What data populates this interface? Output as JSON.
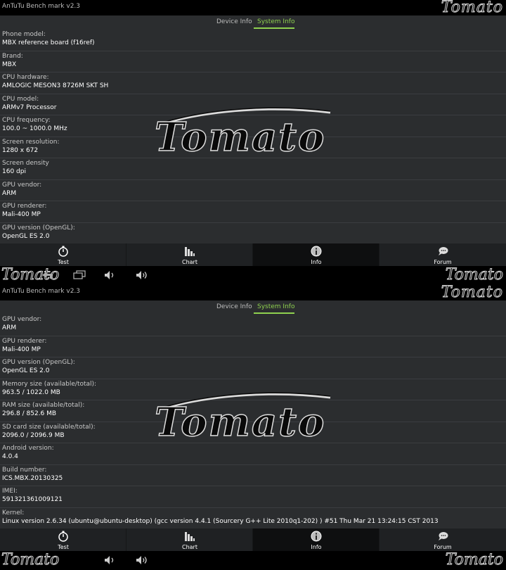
{
  "app_title": "AnTuTu Bench mark v2.3",
  "watermark": "Tomato",
  "tabs": {
    "device_info": "Device Info",
    "system_info": "System Info"
  },
  "top_rows": [
    {
      "label": "Phone model:",
      "value": "MBX reference board (f16ref)"
    },
    {
      "label": "Brand:",
      "value": "MBX"
    },
    {
      "label": "CPU hardware:",
      "value": "AMLOGIC MESON3 8726M SKT SH"
    },
    {
      "label": "CPU model:",
      "value": "ARMv7 Processor"
    },
    {
      "label": "CPU frequency:",
      "value": "100.0 ~ 1000.0 MHz"
    },
    {
      "label": "Screen resolution:",
      "value": "1280 x 672"
    },
    {
      "label": "Screen density",
      "value": "160 dpi"
    },
    {
      "label": "GPU vendor:",
      "value": "ARM"
    },
    {
      "label": "GPU renderer:",
      "value": "Mali-400 MP"
    },
    {
      "label": "GPU version (OpenGL):",
      "value": "OpenGL ES 2.0"
    }
  ],
  "bottom_rows": [
    {
      "label": "GPU vendor:",
      "value": "ARM"
    },
    {
      "label": "GPU renderer:",
      "value": "Mali-400 MP"
    },
    {
      "label": "GPU version (OpenGL):",
      "value": "OpenGL ES 2.0"
    },
    {
      "label": "Memory size (available/total):",
      "value": "963.5 / 1022.0 MB"
    },
    {
      "label": "RAM size (available/total):",
      "value": "296.8 / 852.6 MB"
    },
    {
      "label": "SD card size (available/total):",
      "value": "2096.0 / 2096.9 MB"
    },
    {
      "label": "Android version:",
      "value": "4.0.4"
    },
    {
      "label": "Build number:",
      "value": "ICS.MBX.20130325"
    },
    {
      "label": "IMEI:",
      "value": "591321361009121"
    },
    {
      "label": "Kernel:",
      "value": "Linux version 2.6.34 (ubuntu@ubuntu-desktop) (gcc version 4.4.1 (Sourcery G++ Lite 2010q1-202) ) #51 Thu Mar 21 13:24:15 CST 2013"
    }
  ],
  "nav": {
    "test": "Test",
    "chart": "Chart",
    "info": "Info",
    "forum": "Forum"
  },
  "active_nav": "info",
  "sysbar_icons": [
    "back-icon",
    "recent-apps-icon",
    "volume-down-icon",
    "volume-up-icon"
  ],
  "accent_color": "#8fd14f",
  "clock_color": "#2b90c8"
}
